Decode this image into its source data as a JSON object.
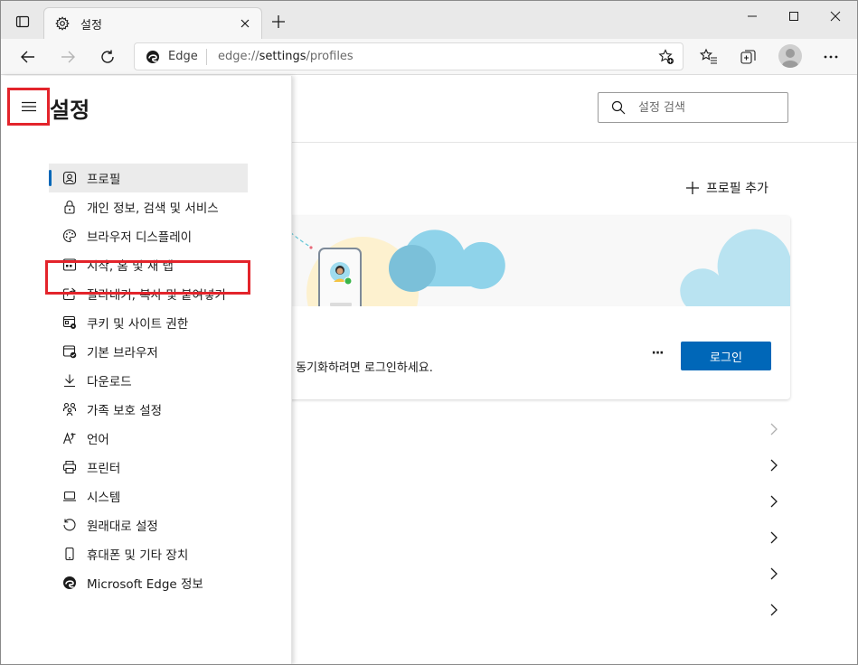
{
  "browser": {
    "tab": {
      "title": "설정"
    },
    "address": {
      "site_label": "Edge",
      "url_prefix": "edge://",
      "url_path": "settings",
      "url_suffix": "/profiles"
    }
  },
  "settings": {
    "title": "설정",
    "search": {
      "placeholder": "설정 검색"
    },
    "add_profile_label": "프로필 추가",
    "profile_card": {
      "sync_text": "를 동기화하려면 로그인하세요.",
      "more_label": "···",
      "login_label": "로그인"
    },
    "nav": {
      "items": [
        {
          "label": "프로필",
          "icon": "profile-icon",
          "active": true
        },
        {
          "label": "개인 정보, 검색 및 서비스",
          "icon": "lock-icon"
        },
        {
          "label": "브라우저 디스플레이",
          "icon": "palette-icon"
        },
        {
          "label": "시작, 홈 및 새 탭",
          "icon": "start-page-icon"
        },
        {
          "label": "잘라내기, 복사 및 붙여넣기",
          "icon": "share-icon"
        },
        {
          "label": "쿠키 및 사이트 권한",
          "icon": "site-permissions-icon"
        },
        {
          "label": "기본 브라우저",
          "icon": "default-browser-icon",
          "highlighted": true
        },
        {
          "label": "다운로드",
          "icon": "download-icon"
        },
        {
          "label": "가족 보호 설정",
          "icon": "family-icon"
        },
        {
          "label": "언어",
          "icon": "language-icon"
        },
        {
          "label": "프린터",
          "icon": "printer-icon"
        },
        {
          "label": "시스템",
          "icon": "laptop-icon"
        },
        {
          "label": "원래대로 설정",
          "icon": "reset-icon"
        },
        {
          "label": "휴대폰 및 기타 장치",
          "icon": "phone-icon"
        },
        {
          "label": "Microsoft Edge 정보",
          "icon": "edge-logo-icon"
        }
      ]
    }
  },
  "colors": {
    "accent": "#0067b8",
    "annotation_red": "#e3242b",
    "cloud": "#8fd3ea"
  }
}
